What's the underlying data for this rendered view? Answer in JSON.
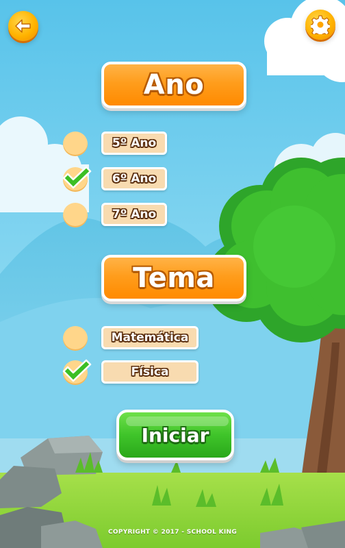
{
  "header": {
    "back_icon": "arrow-left-icon",
    "settings_icon": "gear-icon"
  },
  "year_section": {
    "title": "Ano",
    "options": [
      {
        "label": "5º Ano",
        "checked": false
      },
      {
        "label": "6º Ano",
        "checked": true
      },
      {
        "label": "7º Ano",
        "checked": false
      }
    ]
  },
  "theme_section": {
    "title": "Tema",
    "options": [
      {
        "label": "Matemática",
        "checked": false
      },
      {
        "label": "Física",
        "checked": true
      }
    ]
  },
  "start_button": {
    "label": "Iniciar"
  },
  "footer": {
    "copyright": "COPYRIGHT © 2017 - SCHOOL KING"
  },
  "colors": {
    "sky": "#5ec6ea",
    "title_orange": "#ff9d1c",
    "start_green": "#3fc42a",
    "grass": "#8ed63a",
    "tree_leaves": "#35b92c",
    "option_panel": "#f8dbb0",
    "radio_fill": "#ffd68a",
    "check_green": "#3cbf24"
  }
}
